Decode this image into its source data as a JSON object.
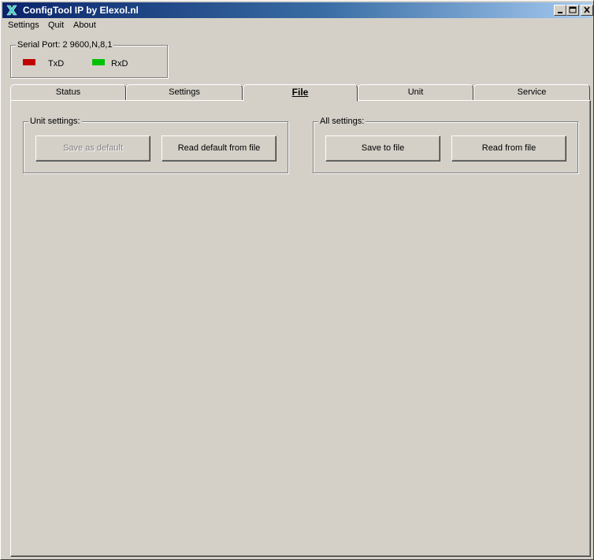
{
  "window": {
    "title": "ConfigTool IP by Elexol.nl"
  },
  "menu": {
    "items": [
      "Settings",
      "Quit",
      "About"
    ]
  },
  "serial_port": {
    "label": "Serial Port: 2 9600,N,8,1",
    "txd_label": "TxD",
    "rxd_label": "RxD",
    "txd_color": "#c00000",
    "rxd_color": "#00c000"
  },
  "tabs": [
    {
      "label": "Status",
      "active": false
    },
    {
      "label": "Settings",
      "active": false
    },
    {
      "label": "File",
      "active": true
    },
    {
      "label": "Unit",
      "active": false
    },
    {
      "label": "Service",
      "active": false
    }
  ],
  "file_tab": {
    "unit_settings": {
      "label": "Unit settings:",
      "save_default_label": "Save as default",
      "save_default_enabled": false,
      "read_default_label": "Read default from file"
    },
    "all_settings": {
      "label": "All settings:",
      "save_label": "Save to file",
      "read_label": "Read from file"
    }
  },
  "colors": {
    "face": "#d4d0c8",
    "title_start": "#0a246a",
    "title_end": "#a6caf0"
  }
}
